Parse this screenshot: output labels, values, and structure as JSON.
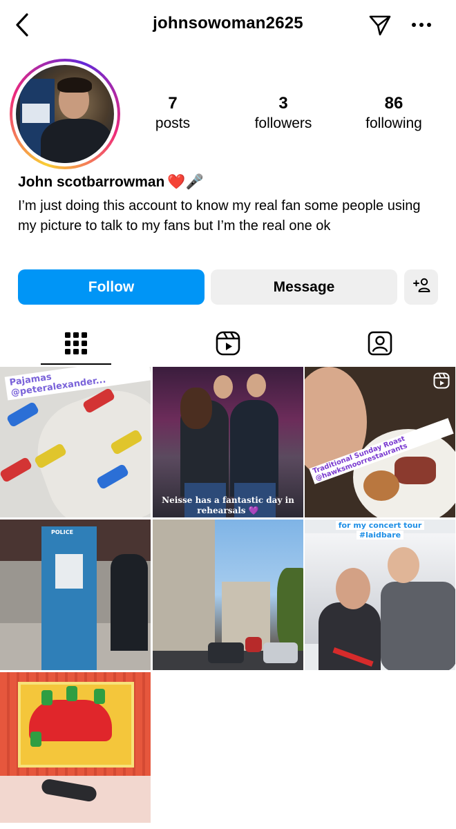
{
  "header": {
    "username": "johnsowoman2625",
    "back_icon": "chevron-left-icon",
    "send_icon": "paper-plane-icon",
    "more_icon": "ellipsis-icon"
  },
  "profile": {
    "display_name": "John scotbarrowman",
    "display_name_emojis": "❤️🎤",
    "bio": "I’m just doing this account to know my real fan some people using my picture to talk to my fans but I’m the real one ok",
    "stats": [
      {
        "value": "7",
        "label": "posts"
      },
      {
        "value": "3",
        "label": "followers"
      },
      {
        "value": "86",
        "label": "following"
      }
    ]
  },
  "actions": {
    "follow_label": "Follow",
    "message_label": "Message",
    "add_user_icon": "add-user-icon"
  },
  "tabs": [
    {
      "name": "grid",
      "icon": "grid-icon",
      "active": true
    },
    {
      "name": "reels",
      "icon": "reels-icon",
      "active": false
    },
    {
      "name": "tagged",
      "icon": "tagged-icon",
      "active": false
    }
  ],
  "posts": [
    {
      "caption": "Pajamas @peteralexander..."
    },
    {
      "caption": "Neisse has a fantastic day in rehearsals 💜"
    },
    {
      "caption": "Traditional Sunday Roast @hawksmoorrestaurants"
    },
    {
      "caption": "POLICE"
    },
    {
      "caption": ""
    },
    {
      "caption_line1": "for my concert tour",
      "caption_line2": "#laidbare"
    },
    {
      "caption": ""
    }
  ],
  "colors": {
    "accent": "#0095f6",
    "button_secondary": "#efefef"
  }
}
